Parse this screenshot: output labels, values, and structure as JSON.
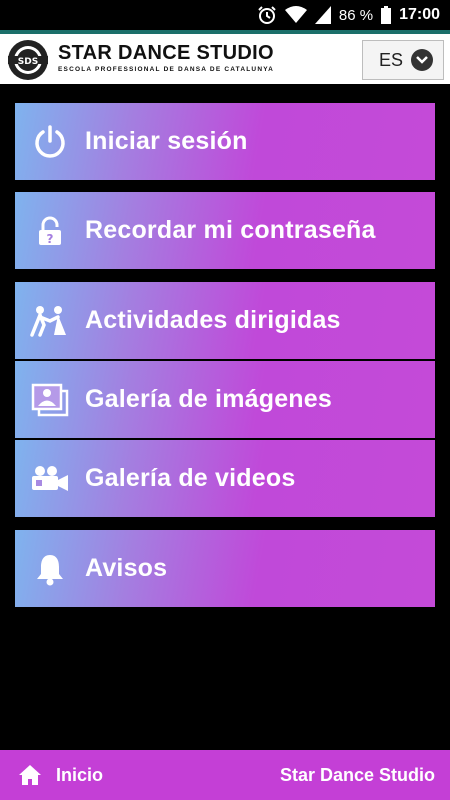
{
  "status": {
    "battery": "86 %",
    "time": "17:00"
  },
  "header": {
    "brand_name": "STAR DANCE STUDIO",
    "tagline": "ESCOLA PROFESSIONAL DE DANSA DE CATALUNYA",
    "language": "ES"
  },
  "menu": [
    {
      "label": "Iniciar sesión",
      "icon": "power-icon"
    },
    {
      "label": "Recordar mi contraseña",
      "icon": "lock-icon"
    },
    {
      "label": "Actividades dirigidas",
      "icon": "dancers-icon"
    },
    {
      "label": "Galería de imágenes",
      "icon": "photos-icon"
    },
    {
      "label": "Galería de videos",
      "icon": "video-camera-icon"
    },
    {
      "label": "Avisos",
      "icon": "bell-icon"
    }
  ],
  "footer": {
    "home_label": "Inicio",
    "site_label": "Star Dance Studio"
  },
  "colors": {
    "accent": "#c43fd6",
    "gradient_start": "#7fb3ee",
    "header_border": "#1b6f6a"
  }
}
